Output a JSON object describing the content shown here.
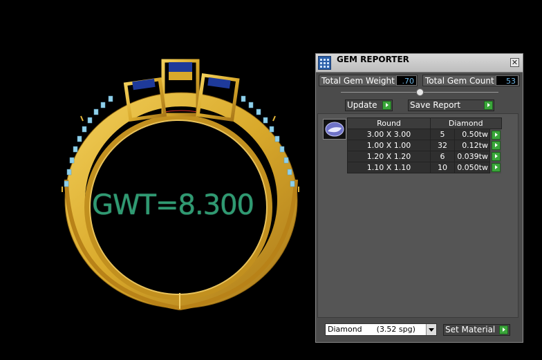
{
  "viewport": {
    "gwt_label": "GWT=8.300"
  },
  "panel": {
    "title": "GEM REPORTER",
    "close_glyph": "✕",
    "total_gem_weight_label": "Total Gem Weight",
    "total_gem_weight_value": ".70",
    "total_gem_count_label": "Total Gem Count",
    "total_gem_count_value": "53",
    "update_label": "Update",
    "save_report_label": "Save Report",
    "table": {
      "headers": [
        "Round",
        "Diamond"
      ],
      "rows": [
        {
          "size": "3.00 X 3.00",
          "count": "5",
          "tw": "0.50tw"
        },
        {
          "size": "1.00 X 1.00",
          "count": "32",
          "tw": "0.12tw"
        },
        {
          "size": "1.20 X 1.20",
          "count": "6",
          "tw": "0.039tw"
        },
        {
          "size": "1.10 X 1.10",
          "count": "10",
          "tw": "0.050tw"
        }
      ]
    },
    "material_select": "Diamond      (3.52 spg)",
    "set_material_label": "Set Material"
  },
  "colors": {
    "gold": "#d9a92b",
    "gwt_text": "#2f9a72",
    "sapphire": "#1e3a9a",
    "side_stones": "#8fd0ea",
    "panel_bg": "#4b4b4b",
    "go_green": "#3aa63a"
  },
  "icons": {
    "app": "grid-app-icon",
    "close": "close-icon",
    "gem": "gem-thumbnail-icon",
    "go": "play-arrow-icon"
  }
}
